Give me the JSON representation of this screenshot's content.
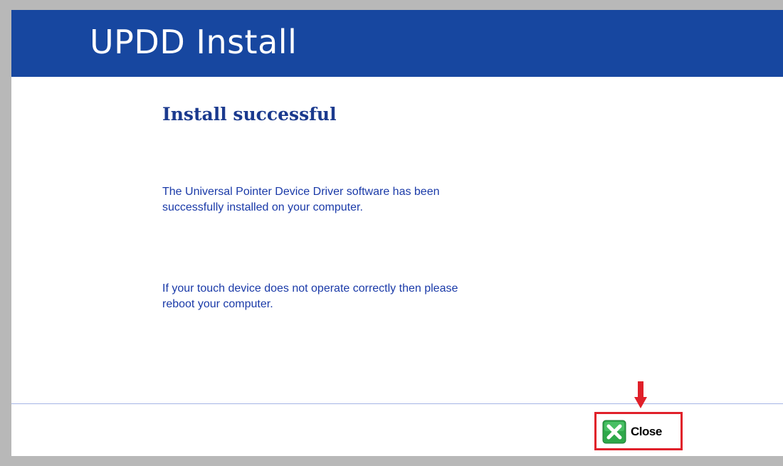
{
  "window": {
    "title": "UPDD Install"
  },
  "content": {
    "heading": "Install successful",
    "message_line1": "The Universal Pointer Device Driver software has been",
    "message_line2": "successfully installed on your computer.",
    "note_line1": "If your touch device does not operate correctly then please",
    "note_line2": "reboot your computer."
  },
  "footer": {
    "close_label": "Close"
  },
  "colors": {
    "header_bg": "#1747a0",
    "heading_text": "#1b3a8e",
    "body_text": "#1a3aa8",
    "highlight": "#e0202a",
    "close_icon_green": "#2ea84a"
  },
  "icons": {
    "close_icon": "green-x-icon",
    "annotation": "red-down-arrow-icon"
  }
}
